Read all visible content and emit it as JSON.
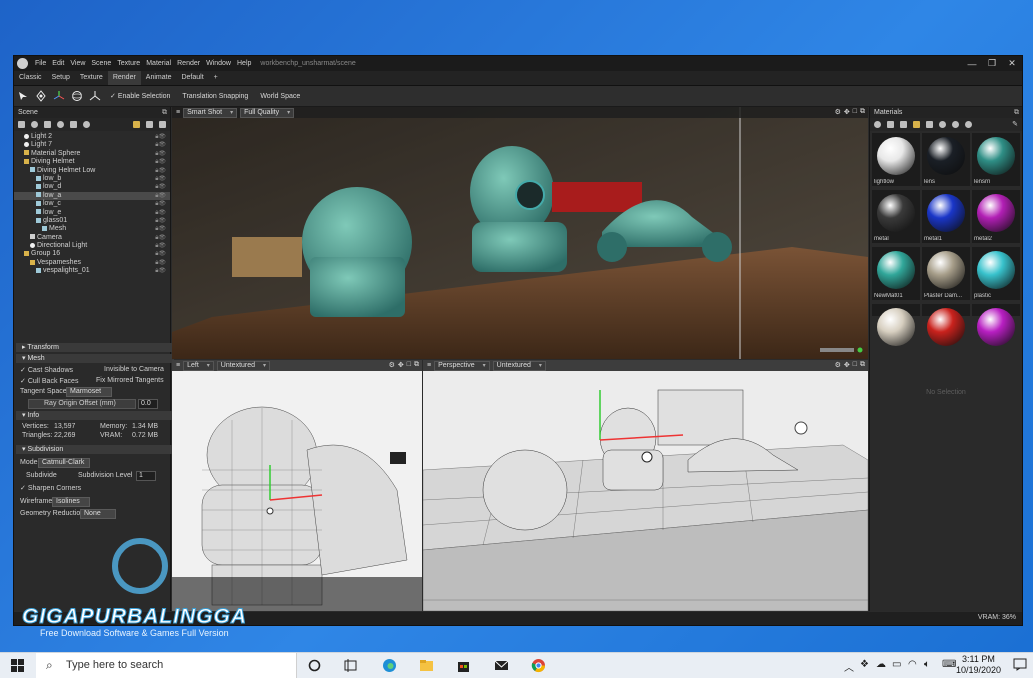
{
  "window": {
    "menu": [
      "File",
      "Edit",
      "View",
      "Scene",
      "Texture",
      "Material",
      "Render",
      "Window",
      "Help"
    ],
    "doc_path": "workbenchp_unsharmat/scene",
    "controls": [
      "—",
      "❐",
      "✕"
    ]
  },
  "workspace_tabs": [
    "Classic",
    "Setup",
    "Texture",
    "Render",
    "Animate",
    "Default",
    "+"
  ],
  "toolbar": {
    "enable_selection": "Enable Selection",
    "translation_snapping": "Translation Snapping",
    "world_space": "World Space"
  },
  "scene": {
    "title": "Scene",
    "tree": [
      {
        "label": "Light 2",
        "type": "light",
        "indent": 1
      },
      {
        "label": "Light 7",
        "type": "light",
        "indent": 1
      },
      {
        "label": "Material Sphere",
        "type": "folder",
        "indent": 1
      },
      {
        "label": "Diving Helmet",
        "type": "folder",
        "indent": 1
      },
      {
        "label": "Diving Helmet Low",
        "type": "mesh",
        "indent": 2
      },
      {
        "label": "low_b",
        "type": "mesh",
        "indent": 3
      },
      {
        "label": "low_d",
        "type": "mesh",
        "indent": 3
      },
      {
        "label": "low_a",
        "type": "mesh",
        "indent": 3,
        "selected": true
      },
      {
        "label": "low_c",
        "type": "mesh",
        "indent": 3
      },
      {
        "label": "low_e",
        "type": "mesh",
        "indent": 3
      },
      {
        "label": "glass01",
        "type": "mesh",
        "indent": 3
      },
      {
        "label": "Mesh",
        "type": "mesh",
        "indent": 4
      },
      {
        "label": "Camera",
        "type": "cam",
        "indent": 2
      },
      {
        "label": "Directional Light",
        "type": "light",
        "indent": 2
      },
      {
        "label": "Group 16",
        "type": "folder",
        "indent": 1
      },
      {
        "label": "Vespameshes",
        "type": "folder",
        "indent": 2
      },
      {
        "label": "vespalights_01",
        "type": "mesh",
        "indent": 3
      }
    ],
    "transform": "Transform",
    "mesh": "Mesh",
    "cast_shadows": "Cast Shadows",
    "invisible_to_camera": "Invisible to Camera",
    "cull_back_faces": "Cull Back Faces",
    "fix_mirrored_tangents": "Fix Mirrored Tangents",
    "tangent_space": "Tangent Space",
    "tangent_space_value": "Marmoset",
    "ray_origin_offset": "Ray Origin Offset (mm)",
    "ray_origin_offset_value": "0.0",
    "info": "Info",
    "vertices_label": "Vertices:",
    "vertices_value": "13,597",
    "triangles_label": "Triangles:",
    "triangles_value": "22,269",
    "memory_label": "Memory:",
    "memory_value": "1.34 MB",
    "vram_label": "VRAM:",
    "vram_value": "0.72 MB",
    "subdivision": "Subdivision",
    "mode_label": "Mode",
    "mode_value": "Catmull-Clark",
    "subdivide": "Subdivide",
    "subdivision_level": "Subdivision Level",
    "subdivision_level_value": "1",
    "sharpen_corners": "Sharpen Corners",
    "wireframe_label": "Wireframe",
    "wireframe_value": "Isolines",
    "geometry_reduction_label": "Geometry Reduction",
    "geometry_reduction_value": "None"
  },
  "viewports": {
    "main": {
      "camera": "Smart Shot",
      "quality": "Full Quality"
    },
    "left": {
      "camera": "Left",
      "shading": "Untextured"
    },
    "persp": {
      "camera": "Perspective",
      "shading": "Untextured"
    }
  },
  "materials": {
    "title": "Materials",
    "items": [
      {
        "label": "lightlow",
        "color": "#e8e8e8"
      },
      {
        "label": "lens",
        "color": "#1a1f26"
      },
      {
        "label": "lensrn",
        "color": "#2f8f86"
      },
      {
        "label": "metal",
        "color": "#3a3a3a"
      },
      {
        "label": "metal1",
        "color": "#1a36c8"
      },
      {
        "label": "metal2",
        "color": "#b21fb5"
      },
      {
        "label": "NewMat01",
        "color": "#31a79a"
      },
      {
        "label": "Plaster Dam...",
        "color": "#a79e8a"
      },
      {
        "label": "plastic",
        "color": "#38c2cc"
      },
      {
        "label": "",
        "color": "#d7cfc0"
      },
      {
        "label": "",
        "color": "#c9221d"
      },
      {
        "label": "",
        "color": "#b81fc2"
      }
    ],
    "no_selection": "No Selection"
  },
  "status": {
    "vram": "VRAM: 36%"
  },
  "watermark": {
    "title": "GIGAPURBALINGGA",
    "subtitle": "Free Download Software & Games Full Version"
  },
  "taskbar": {
    "search_placeholder": "Type here to search",
    "time": "3:11 PM",
    "date": "10/19/2020"
  }
}
